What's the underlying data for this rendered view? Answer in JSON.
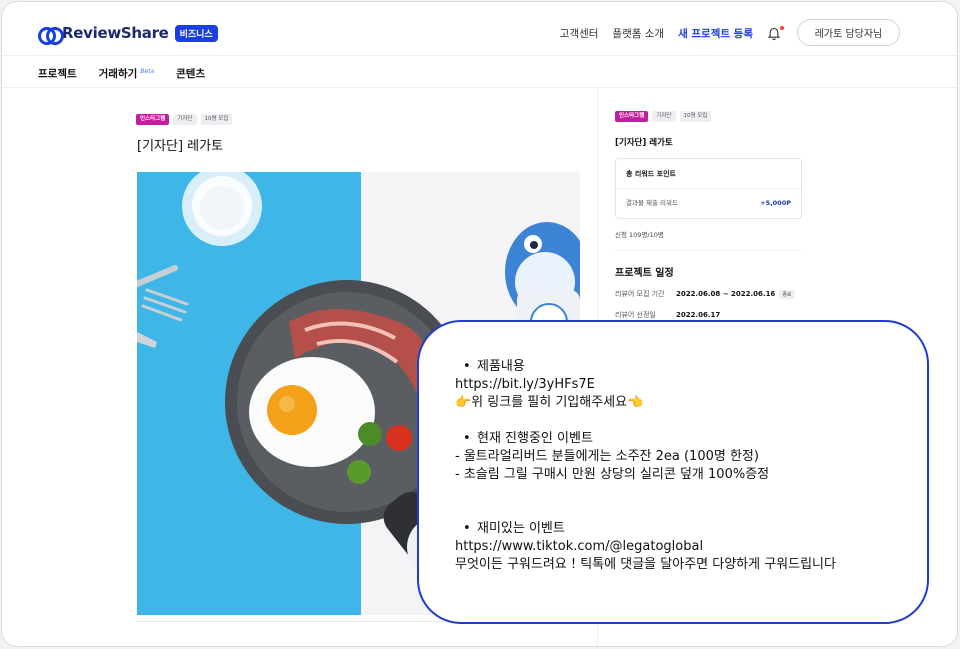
{
  "header": {
    "logo_text": "ReviewShare",
    "logo_badge": "비즈니스",
    "nav": [
      "고객센터",
      "플랫폼 소개",
      "새 프로젝트 등록"
    ],
    "user_button": "레가토 담당자님"
  },
  "subnav": {
    "items": [
      {
        "label": "프로젝트",
        "beta": ""
      },
      {
        "label": "거래하기",
        "beta": "Beta"
      },
      {
        "label": "콘텐츠",
        "beta": ""
      }
    ]
  },
  "project": {
    "tags": [
      "인스타그램",
      "기자단",
      "10명 모집"
    ],
    "title": "[기자단] 레가토"
  },
  "panel": {
    "tags": [
      "인스타그램",
      "기자단",
      "10명 모집"
    ],
    "title": "[기자단] 레가토",
    "reward_header": "총 리워드 포인트",
    "reward_label": "결과물 제출 리워드",
    "reward_value": "+5,000P",
    "apply_status": "신청 109명/10명",
    "schedule_title": "프로젝트 일정",
    "schedule": [
      {
        "key": "리뷰어 모집 기간",
        "value": "2022.06.08 ~ 2022.06.16",
        "badge": "종료"
      },
      {
        "key": "리뷰어 선정일",
        "value": "2022.06.17",
        "badge": ""
      }
    ]
  },
  "overlay": {
    "lines": [
      {
        "type": "bullet",
        "text": "제품내용"
      },
      {
        "type": "text",
        "text": "https://bit.ly/3yHFs7E"
      },
      {
        "type": "text",
        "text": "👉위 링크를 필히 기입해주세요👈"
      },
      {
        "type": "gap"
      },
      {
        "type": "bullet",
        "text": "현재 진행중인 이벤트"
      },
      {
        "type": "text",
        "text": "- 울트라얼리버드 분들에게는 소주잔 2ea (100명 한정)"
      },
      {
        "type": "text",
        "text": "- 초슬림 그릴 구매시 만원 상당의 실리콘 덮개 100%증정"
      },
      {
        "type": "gap2"
      },
      {
        "type": "bullet",
        "text": "재미있는 이벤트"
      },
      {
        "type": "text",
        "text": "https://www.tiktok.com/@legatoglobal"
      },
      {
        "type": "text",
        "text": "무엇이든 구워드려요 ! 틱톡에 댓글을 달아주면 다양하게 구워드립니다"
      }
    ]
  },
  "colors": {
    "brand": "#1a3fe0",
    "instagram_tag": "#c41ea0",
    "hero_blue": "#3eb6e8",
    "bubble_border": "#1e3ccf"
  }
}
